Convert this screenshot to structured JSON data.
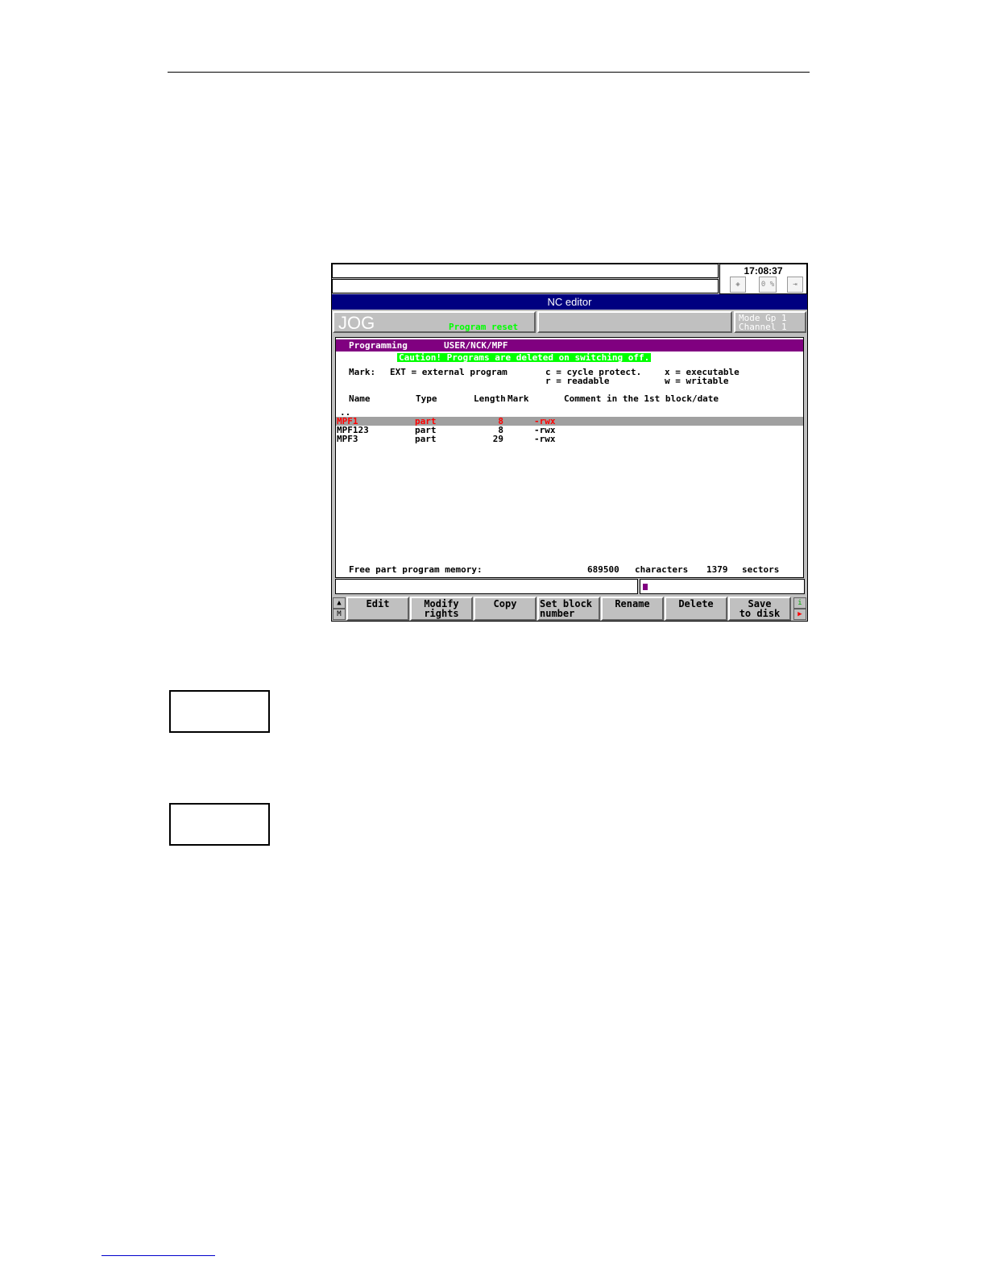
{
  "window": {
    "clock": "17:08:37",
    "title": "NC editor",
    "icons": {
      "left": "machine-icon",
      "middle": "percent-icon",
      "middle_label": "0 %",
      "right": "exit-icon"
    }
  },
  "modebar": {
    "mode": "JOG",
    "program_status": "Program reset",
    "mode_group": "Mode Gp 1",
    "channel": "Channel 1"
  },
  "header": {
    "area": "Programming",
    "path": "USER/NCK/MPF",
    "caution": "Caution! Programs are deleted on switching off."
  },
  "legend": {
    "mark_label": "Mark:",
    "ext": "EXT = external program",
    "c": "c = cycle protect.",
    "r": "r = readable",
    "x": "x = executable",
    "w": "w = writable"
  },
  "table": {
    "columns": [
      "Name",
      "Type",
      "Length",
      "Mark",
      "Comment in the 1st block/date"
    ],
    "parent": "..",
    "rows": [
      {
        "name": "MPF1",
        "type": "part",
        "length": "8",
        "mark": "-rwx"
      },
      {
        "name": "MPF123",
        "type": "part",
        "length": "8",
        "mark": "-rwx"
      },
      {
        "name": "MPF3",
        "type": "part",
        "length": "29",
        "mark": "-rwx"
      }
    ],
    "selected_index": 0
  },
  "memory": {
    "label": "Free part program memory:",
    "characters": "689500",
    "characters_unit": "characters",
    "sectors": "1379",
    "sectors_unit": "sectors"
  },
  "softkeys": [
    "Edit",
    "Modify\nrights",
    "Copy",
    "Set block\nnumber",
    "Rename",
    "Delete",
    "Save\nto disk"
  ],
  "side_left": {
    "up": "▲",
    "m": "M"
  },
  "side_right": {
    "i": "i",
    "next": "▶"
  },
  "colors": {
    "title_bar": "#000080",
    "header_bar": "#800080",
    "caution_bg": "#00ff00",
    "selection_text": "#ff0000"
  }
}
